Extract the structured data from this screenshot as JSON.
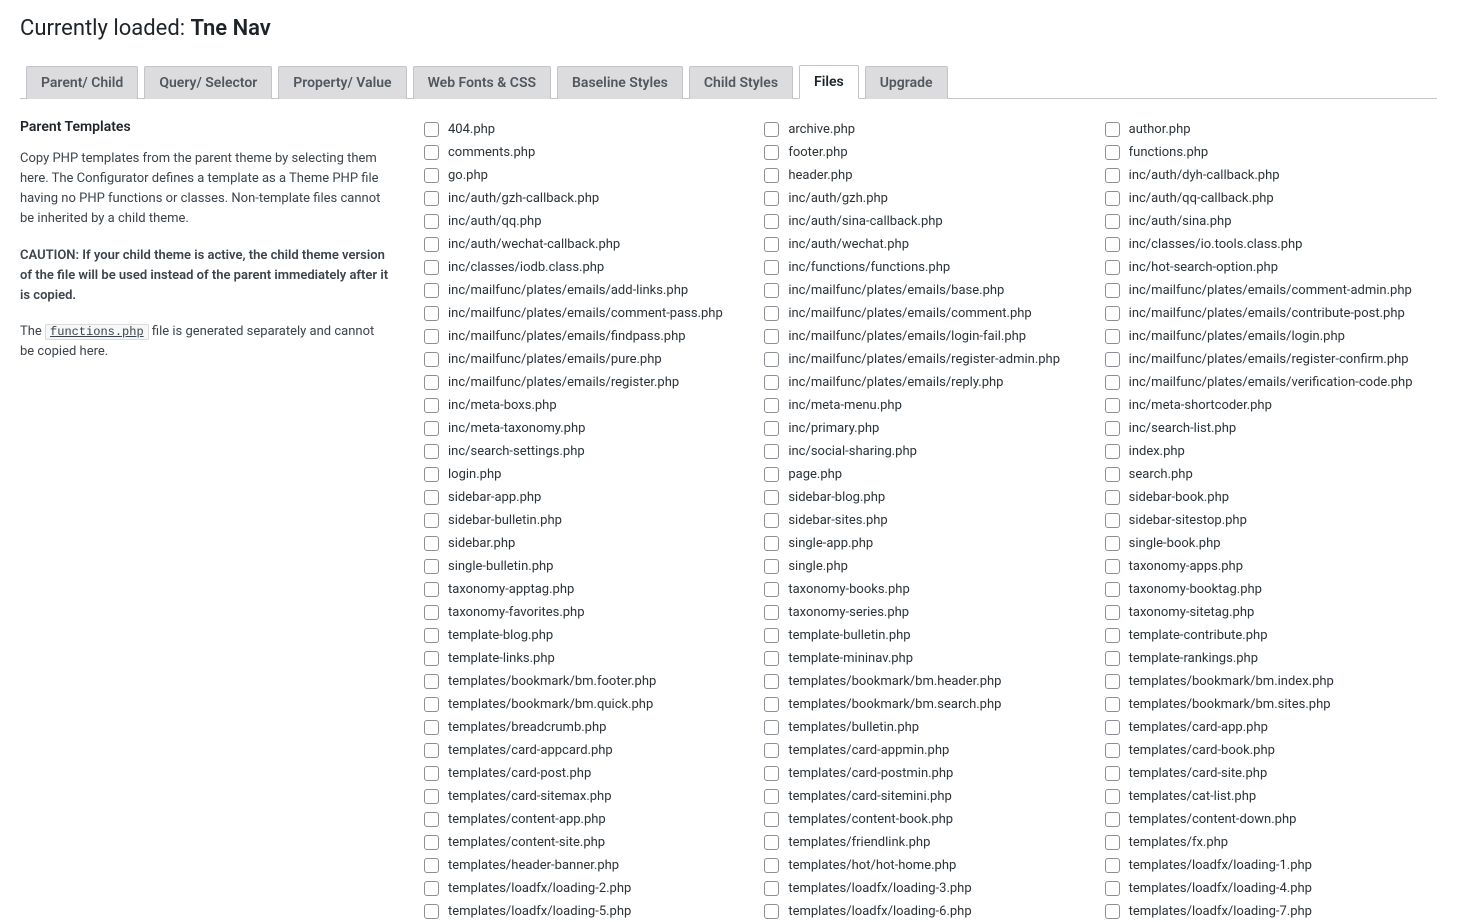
{
  "header": {
    "loaded_label": "Currently loaded:",
    "loaded_name": "Tne Nav"
  },
  "tabs": [
    {
      "label": "Parent/ Child",
      "active": false
    },
    {
      "label": "Query/ Selector",
      "active": false
    },
    {
      "label": "Property/ Value",
      "active": false
    },
    {
      "label": "Web Fonts & CSS",
      "active": false
    },
    {
      "label": "Baseline Styles",
      "active": false
    },
    {
      "label": "Child Styles",
      "active": false
    },
    {
      "label": "Files",
      "active": true
    },
    {
      "label": "Upgrade",
      "active": false
    }
  ],
  "side": {
    "title": "Parent Templates",
    "p1": "Copy PHP templates from the parent theme by selecting them here. The Configurator defines a template as a Theme PHP file having no PHP functions or classes. Non-template files cannot be inherited by a child theme.",
    "caution": "CAUTION: If your child theme is active, the child theme version of the file will be used instead of the parent immediately after it is copied.",
    "p3a": "The ",
    "func": "functions.php",
    "p3b": " file is generated separately and cannot be copied here."
  },
  "files": [
    "404.php",
    "archive.php",
    "author.php",
    "comments.php",
    "footer.php",
    "functions.php",
    "go.php",
    "header.php",
    "inc/auth/dyh-callback.php",
    "inc/auth/gzh-callback.php",
    "inc/auth/gzh.php",
    "inc/auth/qq-callback.php",
    "inc/auth/qq.php",
    "inc/auth/sina-callback.php",
    "inc/auth/sina.php",
    "inc/auth/wechat-callback.php",
    "inc/auth/wechat.php",
    "inc/classes/io.tools.class.php",
    "inc/classes/iodb.class.php",
    "inc/functions/functions.php",
    "inc/hot-search-option.php",
    "inc/mailfunc/plates/emails/add-links.php",
    "inc/mailfunc/plates/emails/base.php",
    "inc/mailfunc/plates/emails/comment-admin.php",
    "inc/mailfunc/plates/emails/comment-pass.php",
    "inc/mailfunc/plates/emails/comment.php",
    "inc/mailfunc/plates/emails/contribute-post.php",
    "inc/mailfunc/plates/emails/findpass.php",
    "inc/mailfunc/plates/emails/login-fail.php",
    "inc/mailfunc/plates/emails/login.php",
    "inc/mailfunc/plates/emails/pure.php",
    "inc/mailfunc/plates/emails/register-admin.php",
    "inc/mailfunc/plates/emails/register-confirm.php",
    "inc/mailfunc/plates/emails/register.php",
    "inc/mailfunc/plates/emails/reply.php",
    "inc/mailfunc/plates/emails/verification-code.php",
    "inc/meta-boxs.php",
    "inc/meta-menu.php",
    "inc/meta-shortcoder.php",
    "inc/meta-taxonomy.php",
    "inc/primary.php",
    "inc/search-list.php",
    "inc/search-settings.php",
    "inc/social-sharing.php",
    "index.php",
    "login.php",
    "page.php",
    "search.php",
    "sidebar-app.php",
    "sidebar-blog.php",
    "sidebar-book.php",
    "sidebar-bulletin.php",
    "sidebar-sites.php",
    "sidebar-sitestop.php",
    "sidebar.php",
    "single-app.php",
    "single-book.php",
    "single-bulletin.php",
    "single.php",
    "taxonomy-apps.php",
    "taxonomy-apptag.php",
    "taxonomy-books.php",
    "taxonomy-booktag.php",
    "taxonomy-favorites.php",
    "taxonomy-series.php",
    "taxonomy-sitetag.php",
    "template-blog.php",
    "template-bulletin.php",
    "template-contribute.php",
    "template-links.php",
    "template-mininav.php",
    "template-rankings.php",
    "templates/bookmark/bm.footer.php",
    "templates/bookmark/bm.header.php",
    "templates/bookmark/bm.index.php",
    "templates/bookmark/bm.quick.php",
    "templates/bookmark/bm.search.php",
    "templates/bookmark/bm.sites.php",
    "templates/breadcrumb.php",
    "templates/bulletin.php",
    "templates/card-app.php",
    "templates/card-appcard.php",
    "templates/card-appmin.php",
    "templates/card-book.php",
    "templates/card-post.php",
    "templates/card-postmin.php",
    "templates/card-site.php",
    "templates/card-sitemax.php",
    "templates/card-sitemini.php",
    "templates/cat-list.php",
    "templates/content-app.php",
    "templates/content-book.php",
    "templates/content-down.php",
    "templates/content-site.php",
    "templates/friendlink.php",
    "templates/fx.php",
    "templates/header-banner.php",
    "templates/hot/hot-home.php",
    "templates/loadfx/loading-1.php",
    "templates/loadfx/loading-2.php",
    "templates/loadfx/loading-3.php",
    "templates/loadfx/loading-4.php",
    "templates/loadfx/loading-5.php",
    "templates/loadfx/loading-6.php",
    "templates/loadfx/loading-7.php"
  ]
}
